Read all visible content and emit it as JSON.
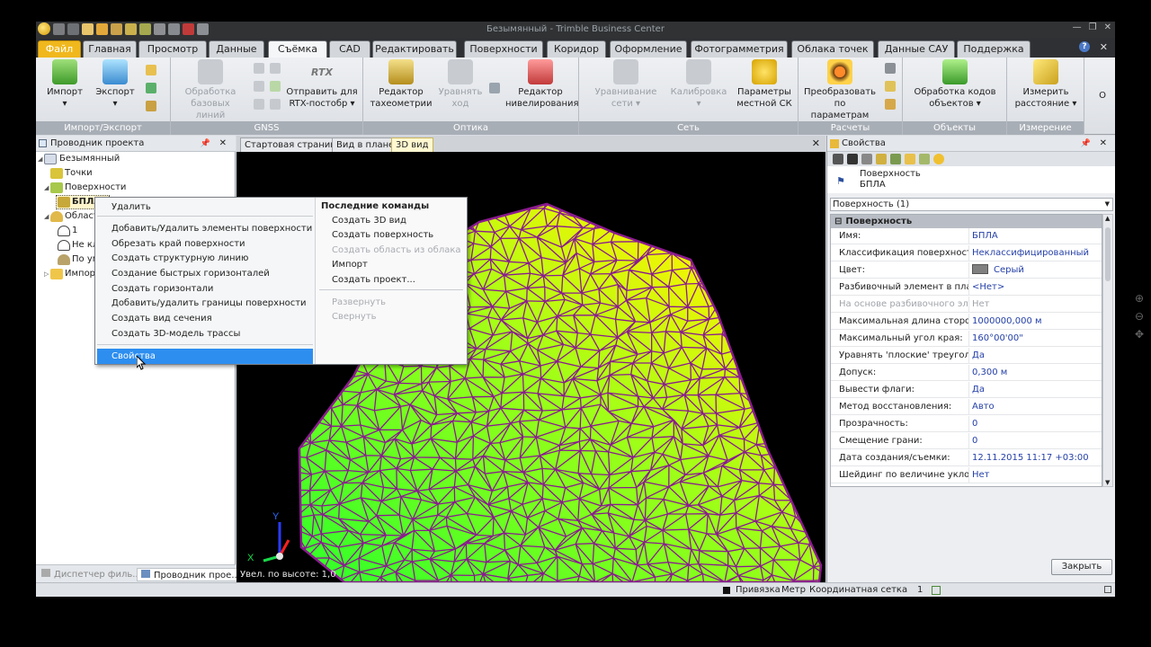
{
  "window": {
    "title": "Безымянный - Trimble Business Center"
  },
  "ribbon_tabs": [
    {
      "label": "Файл",
      "kind": "file"
    },
    {
      "label": "Главная"
    },
    {
      "label": "Просмотр"
    },
    {
      "label": "Данные"
    },
    {
      "label": "Съёмка",
      "kind": "active"
    },
    {
      "label": "CAD"
    },
    {
      "label": "Редактировать"
    },
    {
      "label": "Поверхности"
    },
    {
      "label": "Коридор"
    },
    {
      "label": "Оформление"
    },
    {
      "label": "Фотограмметрия"
    },
    {
      "label": "Облака точек"
    },
    {
      "label": "Данные САУ"
    },
    {
      "label": "Поддержка"
    }
  ],
  "ribbon": {
    "groups": [
      {
        "label": "Импорт/Экспорт"
      },
      {
        "label": "GNSS"
      },
      {
        "label": "Оптика"
      },
      {
        "label": "Сеть"
      },
      {
        "label": "Расчеты"
      },
      {
        "label": "Объекты"
      },
      {
        "label": "Измерение"
      }
    ],
    "buttons": {
      "import": {
        "l1": "Импорт",
        "l2": "▾"
      },
      "export": {
        "l1": "Экспорт",
        "l2": "▾"
      },
      "baseline": {
        "l1": "Обработка",
        "l2": "базовых линий"
      },
      "rtx_logo": "RTX",
      "rtx": {
        "l1": "Отправить для",
        "l2": "RTX-постобр ▾"
      },
      "tach": {
        "l1": "Редактор",
        "l2": "тахеометрии"
      },
      "equalize": {
        "l1": "Уравнять",
        "l2": "ход"
      },
      "level": {
        "l1": "Редактор",
        "l2": "нивелирования"
      },
      "adjust_net": {
        "l1": "Уравнивание",
        "l2": "сети ▾"
      },
      "calib": {
        "l1": "Калибровка",
        "l2": "▾"
      },
      "local_cs": {
        "l1": "Параметры",
        "l2": "местной СК"
      },
      "transform": {
        "l1": "Преобразовать",
        "l2": "по параметрам"
      },
      "obj_codes": {
        "l1": "Обработка кодов",
        "l2": "объектов ▾"
      },
      "measure": {
        "l1": "Измерить",
        "l2": "расстояние ▾"
      },
      "more": "О"
    }
  },
  "explorer": {
    "title": "Проводник проекта",
    "tree": [
      {
        "label": "Безымянный",
        "icon": "project-icon"
      },
      {
        "label": "Точки",
        "icon": "points-icon"
      },
      {
        "label": "Поверхности",
        "icon": "surfaces-icon"
      },
      {
        "label": "БПЛА",
        "icon": "surface-icon"
      },
      {
        "label": "Област",
        "icon": "areas-icon"
      },
      {
        "label": "1",
        "icon": "area-icon"
      },
      {
        "label": "Не кл",
        "icon": "area-icon"
      },
      {
        "label": "По ум",
        "icon": "area-icon"
      },
      {
        "label": "Импорт",
        "icon": "folder-icon"
      }
    ],
    "bottom_tabs": [
      "Диспетчер филь...",
      "Проводник прое..."
    ]
  },
  "view_tabs": [
    "Стартовая страница",
    "Вид в плане",
    "3D вид"
  ],
  "viewport": {
    "zoom_label": "Увел. по высоте: 1,0",
    "axis_x": "X",
    "axis_y": "Y"
  },
  "context_menu": {
    "left_items": [
      {
        "label": "Удалить"
      },
      {
        "label": "Добавить/Удалить элементы поверхности"
      },
      {
        "label": "Обрезать край поверхности"
      },
      {
        "label": "Создать структурную линию"
      },
      {
        "label": "Создание быстрых горизонталей"
      },
      {
        "label": "Создать горизонтали"
      },
      {
        "label": "Добавить/удалить границы поверхности"
      },
      {
        "label": "Создать вид сечения"
      },
      {
        "label": "Создать 3D-модель трассы"
      },
      {
        "label": "Свойства",
        "state": "highlighted"
      }
    ],
    "recent_title": "Последние команды",
    "right_items": [
      {
        "label": "Создать 3D вид"
      },
      {
        "label": "Создать поверхность"
      },
      {
        "label": "Создать область из облака",
        "state": "disabled"
      },
      {
        "label": "Импорт"
      },
      {
        "label": "Создать проект..."
      },
      {
        "label": "Развернуть",
        "state": "disabled"
      },
      {
        "label": "Свернуть",
        "state": "disabled"
      }
    ]
  },
  "properties": {
    "title": "Свойства",
    "object_type": "Поверхность",
    "object_name": "БПЛА",
    "selection": "Поверхность (1)",
    "section": "Поверхность",
    "rows": [
      {
        "key": "Имя:",
        "value": "БПЛА"
      },
      {
        "key": "Классификация поверхности:",
        "value": "Неклассифицированный"
      },
      {
        "key": "Цвет:",
        "value": "Серый",
        "swatch": "#808080"
      },
      {
        "key": "Разбивочный элемент в план",
        "value": "<Нет>"
      },
      {
        "key": "На основе разбивочного эле",
        "value": "Нет",
        "disabled": true
      },
      {
        "key": "Максимальная длина сторон",
        "value": "1000000,000 м"
      },
      {
        "key": "Максимальный угол края:",
        "value": "160°00'00\""
      },
      {
        "key": "Уравнять 'плоские' треугольн",
        "value": "Да"
      },
      {
        "key": "Допуск:",
        "value": "0,300 м"
      },
      {
        "key": "Вывести флаги:",
        "value": "Да"
      },
      {
        "key": "Метод восстановления:",
        "value": "Авто"
      },
      {
        "key": "Прозрачность:",
        "value": "0"
      },
      {
        "key": "Смещение грани:",
        "value": "0"
      },
      {
        "key": "Дата создания/съемки:",
        "value": "12.11.2015 11:17 +03:00"
      },
      {
        "key": "Шейдинг по величине уклона:",
        "value": "Нет"
      }
    ],
    "close_button": "Закрыть"
  },
  "statusbar": {
    "snap": "Привязка",
    "units": "Метр",
    "grid": "Координатная сетка",
    "count": "1"
  },
  "colors": {
    "accent": "#f0b81d",
    "highlight": "#2d8ef0",
    "mesh": "#8b1a8f",
    "surface_low": "#33ff22",
    "surface_high": "#ffff00"
  }
}
